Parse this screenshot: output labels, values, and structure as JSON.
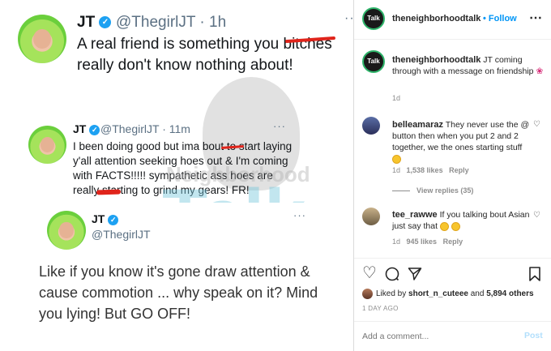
{
  "tweet1": {
    "name": "JT",
    "handle": "@ThegirlJT",
    "time": "· 1h",
    "text": "A real friend is something you bitches really don't know nothing about!"
  },
  "tweet2": {
    "name": "JT",
    "handle": "@ThegirlJT",
    "time": "· 11m",
    "text": "I been doing good but ima bout to start laying y'all attention seeking hoes out & I'm coming with FACTS!!!!! sympathetic ass hoes are really starting to grind my gears! FR!"
  },
  "tweet3": {
    "name": "JT",
    "handle": "@ThegirlJT",
    "text": "Like if you know it's gone draw attention & cause commotion ... why speak on it? Mind you lying! But GO OFF!"
  },
  "watermark": {
    "top": "Neighborhood",
    "big": "Talk"
  },
  "ig": {
    "account": "theneighborhoodtalk",
    "follow": "• Follow",
    "avatar_text": "Talk",
    "caption_user": "theneighborhoodtalk",
    "caption": " JT coming through with a message on friendship",
    "caption_age": "1d",
    "comments": [
      {
        "user": "belleamaraz",
        "text": " They never use the @ button then when you put 2 and 2 together, we the ones starting stuff",
        "age": "1d",
        "likes": "1,538 likes",
        "reply": "Reply",
        "view_replies": "View replies (35)"
      },
      {
        "user": "tee_rawwe",
        "text": " If you talking bout Asian just say that",
        "age": "1d",
        "likes": "945 likes",
        "reply": "Reply"
      }
    ],
    "liked_prefix": "Liked by ",
    "liked_user": "short_n_cuteee",
    "liked_mid": " and ",
    "liked_count": "5,894 others",
    "date": "1 DAY AGO",
    "comment_placeholder": "Add a comment...",
    "post_label": "Post",
    "colors": {
      "accent": "#0095f6",
      "verified": "#1da1f2",
      "redact": "#e0241b"
    }
  }
}
